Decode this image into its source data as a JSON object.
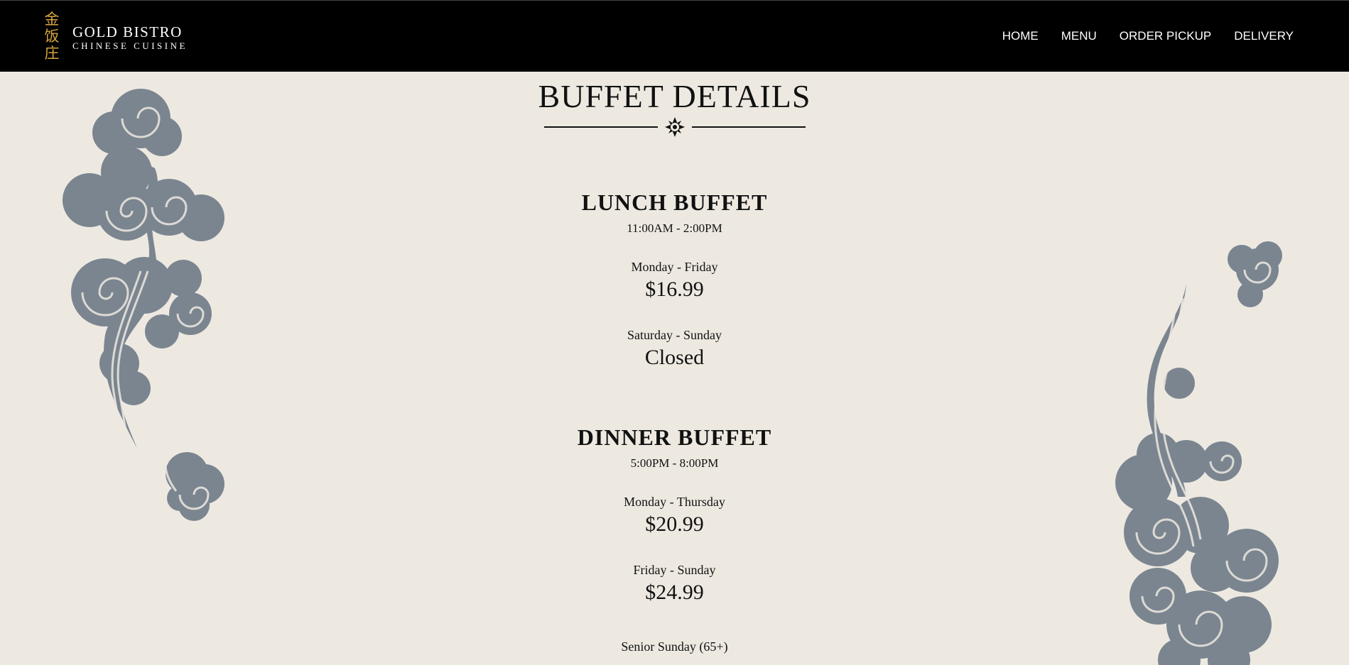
{
  "brand": {
    "chinese_chars": [
      "金",
      "饭",
      "庄"
    ],
    "name": "GOLD BISTRO",
    "subtitle": "CHINESE CUISINE",
    "accent_color": "#d6a441"
  },
  "nav": {
    "items": [
      {
        "label": "HOME"
      },
      {
        "label": "MENU"
      },
      {
        "label": "ORDER PICKUP"
      },
      {
        "label": "DELIVERY"
      }
    ]
  },
  "page": {
    "title": "BUFFET DETAILS",
    "divider_icon": "sun-ornament-icon"
  },
  "lunch": {
    "title": "LUNCH BUFFET",
    "hours": "11:00AM - 2:00PM",
    "rows": [
      {
        "days": "Monday - Friday",
        "price": "$16.99"
      },
      {
        "days": "Saturday - Sunday",
        "price": "Closed"
      }
    ]
  },
  "dinner": {
    "title": "DINNER BUFFET",
    "hours": "5:00PM - 8:00PM",
    "rows": [
      {
        "days": "Monday - Thursday",
        "price": "$20.99"
      },
      {
        "days": "Friday - Sunday",
        "price": "$24.99"
      },
      {
        "days": "Senior Sunday (65+)"
      }
    ]
  },
  "colors": {
    "background": "#ede9e1",
    "header": "#000000",
    "cloud": "#7b8590"
  }
}
